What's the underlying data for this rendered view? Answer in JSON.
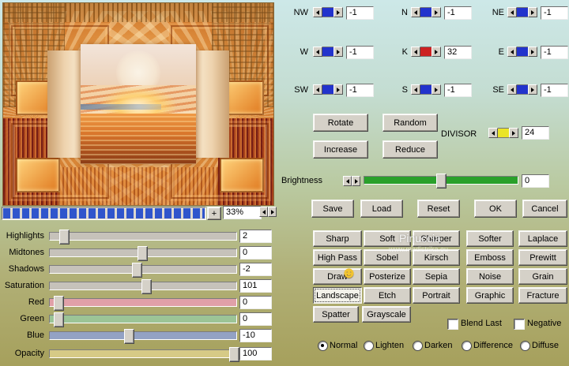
{
  "window": {
    "watermark": "Pinuccia",
    "watermark_url": "www.madistrika.eu",
    "smiley": "☻"
  },
  "preview": {
    "zoom_value": "33%",
    "zoom_plus_label": "+"
  },
  "matrix": {
    "cells": [
      {
        "label": "NW",
        "value": "-1"
      },
      {
        "label": "N",
        "value": "-1"
      },
      {
        "label": "NE",
        "value": "-1"
      },
      {
        "label": "W",
        "value": "-1"
      },
      {
        "label": "K",
        "value": "32"
      },
      {
        "label": "E",
        "value": "-1"
      },
      {
        "label": "SW",
        "value": "-1"
      },
      {
        "label": "S",
        "value": "-1"
      },
      {
        "label": "SE",
        "value": "-1"
      }
    ],
    "divisor_label": "DIVISOR",
    "divisor_value": "24"
  },
  "kernel_buttons": {
    "rotate": "Rotate",
    "random": "Random",
    "increase": "Increase",
    "reduce": "Reduce"
  },
  "brightness": {
    "label": "Brightness",
    "value": "0"
  },
  "actions": {
    "save": "Save",
    "load": "Load",
    "reset": "Reset",
    "ok": "OK",
    "cancel": "Cancel"
  },
  "filters": [
    "Sharp",
    "Soft",
    "Sharper",
    "Softer",
    "Laplace",
    "High Pass",
    "Sobel",
    "Kirsch",
    "Emboss",
    "Prewitt",
    "Draw",
    "Posterize",
    "Sepia",
    "Noise",
    "Grain",
    "Landscape",
    "Etch",
    "Portrait",
    "Graphic",
    "Fracture",
    "Spatter",
    "Grayscale"
  ],
  "selected_filter": "Landscape",
  "options": {
    "blend_last": "Blend Last",
    "negative": "Negative"
  },
  "blend_modes": [
    "Normal",
    "Lighten",
    "Darken",
    "Difference",
    "Diffuse"
  ],
  "selected_mode": "Normal",
  "sliders": [
    {
      "label": "Highlights",
      "value": "2"
    },
    {
      "label": "Midtones",
      "value": "0"
    },
    {
      "label": "Shadows",
      "value": "-2"
    },
    {
      "label": "Saturation",
      "value": "101"
    },
    {
      "label": "Red",
      "value": "0"
    },
    {
      "label": "Green",
      "value": "0"
    },
    {
      "label": "Blue",
      "value": "-10"
    },
    {
      "label": "Opacity",
      "value": "100"
    }
  ],
  "colors": {
    "spinner_blue": "#2233cc",
    "spinner_red": "#cc2222",
    "spinner_yellow": "#eae428",
    "brightness_green": "#2aa02a",
    "progress_blue": "#2f55cc",
    "slider_red_track": "#e0a0a8",
    "slider_green_track": "#9cc496",
    "slider_blue_track": "#93a2c4",
    "slider_opacity_track": "#d6ca86"
  }
}
